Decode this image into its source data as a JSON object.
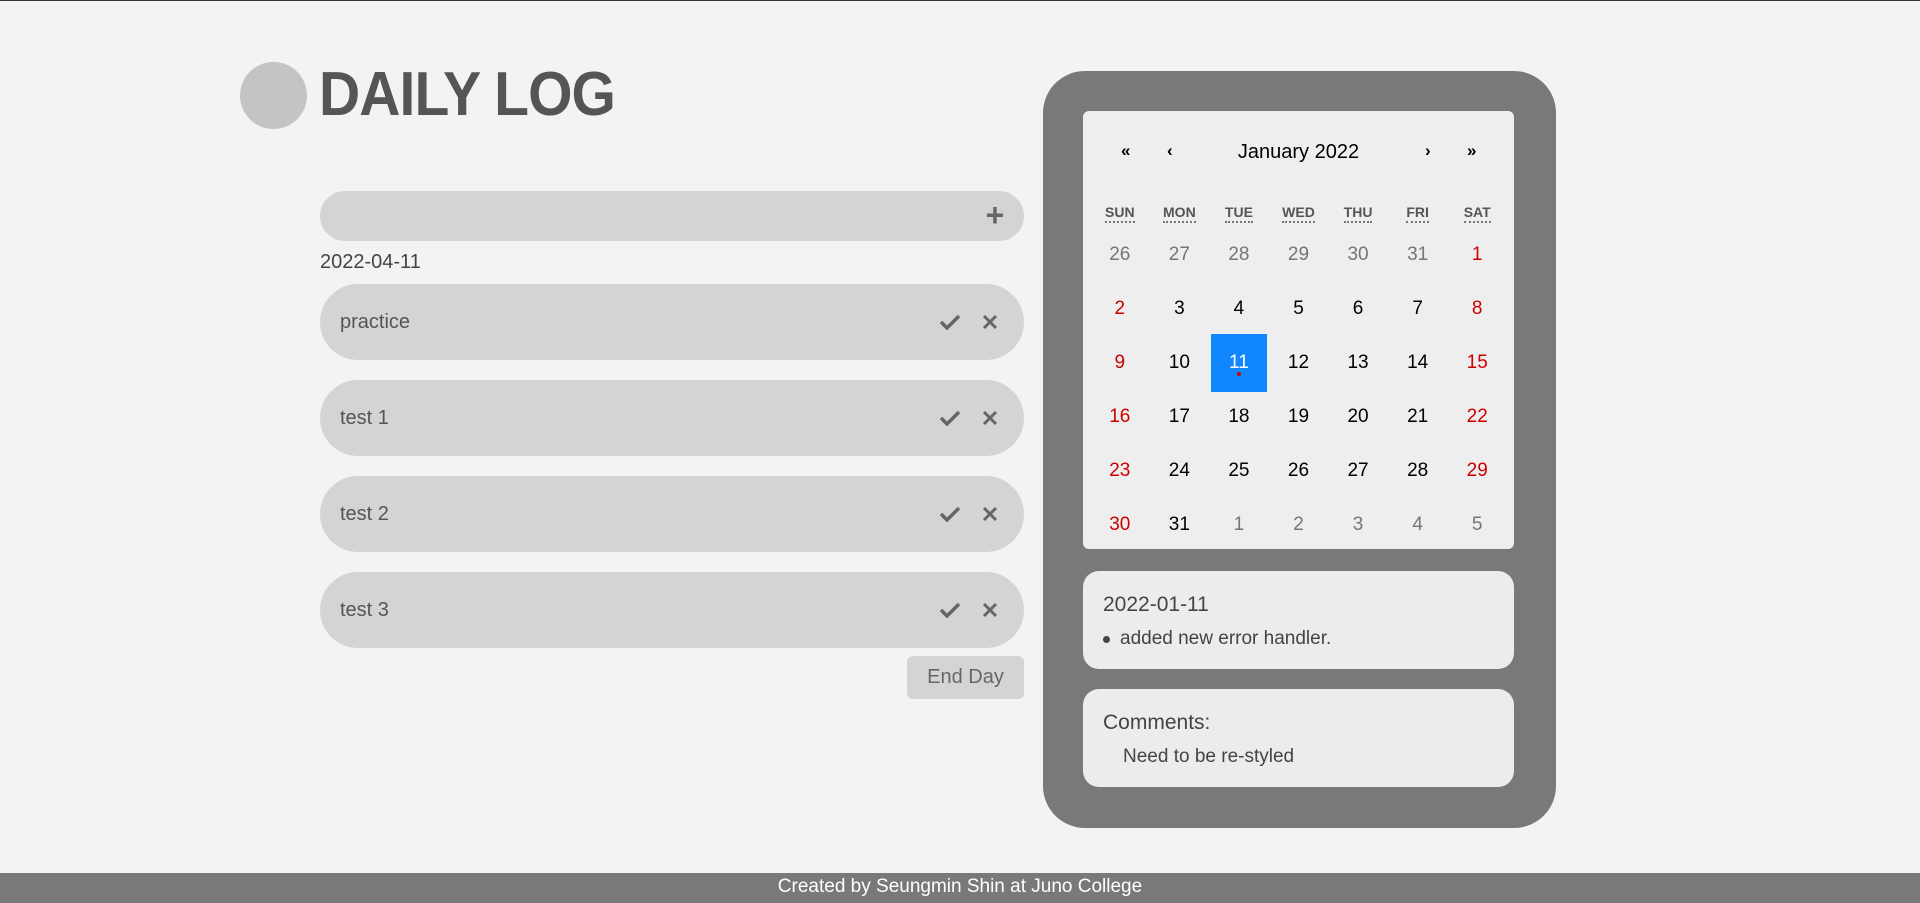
{
  "app": {
    "title": "DAILY LOG"
  },
  "task_input": {
    "value": "",
    "placeholder": "",
    "add_icon": "plus-icon",
    "add_glyph": "+"
  },
  "current_date": "2022-04-11",
  "tasks": [
    {
      "label": "practice"
    },
    {
      "label": "test 1"
    },
    {
      "label": "test 2"
    },
    {
      "label": "test 3"
    }
  ],
  "task_actions": {
    "complete_icon": "check-icon",
    "delete_icon": "close-icon"
  },
  "end_day_label": "End Day",
  "calendar": {
    "prev_year": "«",
    "prev_month": "‹",
    "month_label": "January 2022",
    "next_month": "›",
    "next_year": "»",
    "weekdays": [
      "SUN",
      "MON",
      "TUE",
      "WED",
      "THU",
      "FRI",
      "SAT"
    ],
    "selected_color": "#1087ff",
    "weekend_color": "#cc0000",
    "weeks": [
      [
        {
          "day": "26",
          "type": "neighbor"
        },
        {
          "day": "27",
          "type": "neighbor"
        },
        {
          "day": "28",
          "type": "neighbor"
        },
        {
          "day": "29",
          "type": "neighbor"
        },
        {
          "day": "30",
          "type": "neighbor"
        },
        {
          "day": "31",
          "type": "neighbor"
        },
        {
          "day": "1",
          "type": "weekend"
        }
      ],
      [
        {
          "day": "2",
          "type": "weekend"
        },
        {
          "day": "3",
          "type": "normal"
        },
        {
          "day": "4",
          "type": "normal"
        },
        {
          "day": "5",
          "type": "normal"
        },
        {
          "day": "6",
          "type": "normal"
        },
        {
          "day": "7",
          "type": "normal"
        },
        {
          "day": "8",
          "type": "weekend"
        }
      ],
      [
        {
          "day": "9",
          "type": "weekend"
        },
        {
          "day": "10",
          "type": "normal"
        },
        {
          "day": "11",
          "type": "selected",
          "has_entry": true
        },
        {
          "day": "12",
          "type": "normal"
        },
        {
          "day": "13",
          "type": "normal"
        },
        {
          "day": "14",
          "type": "normal"
        },
        {
          "day": "15",
          "type": "weekend"
        }
      ],
      [
        {
          "day": "16",
          "type": "weekend"
        },
        {
          "day": "17",
          "type": "normal"
        },
        {
          "day": "18",
          "type": "normal"
        },
        {
          "day": "19",
          "type": "normal"
        },
        {
          "day": "20",
          "type": "normal"
        },
        {
          "day": "21",
          "type": "normal"
        },
        {
          "day": "22",
          "type": "weekend"
        }
      ],
      [
        {
          "day": "23",
          "type": "weekend"
        },
        {
          "day": "24",
          "type": "normal"
        },
        {
          "day": "25",
          "type": "normal"
        },
        {
          "day": "26",
          "type": "normal"
        },
        {
          "day": "27",
          "type": "normal"
        },
        {
          "day": "28",
          "type": "normal"
        },
        {
          "day": "29",
          "type": "weekend"
        }
      ],
      [
        {
          "day": "30",
          "type": "weekend"
        },
        {
          "day": "31",
          "type": "normal"
        },
        {
          "day": "1",
          "type": "neighbor"
        },
        {
          "day": "2",
          "type": "neighbor"
        },
        {
          "day": "3",
          "type": "neighbor"
        },
        {
          "day": "4",
          "type": "neighbor"
        },
        {
          "day": "5",
          "type": "neighbor"
        }
      ]
    ]
  },
  "log": {
    "date": "2022-01-11",
    "entries": [
      "added new error handler."
    ]
  },
  "comments": {
    "heading": "Comments:",
    "text": "Need to be re-styled"
  },
  "footer": {
    "text": "Created by Seungmin Shin at Juno College"
  }
}
